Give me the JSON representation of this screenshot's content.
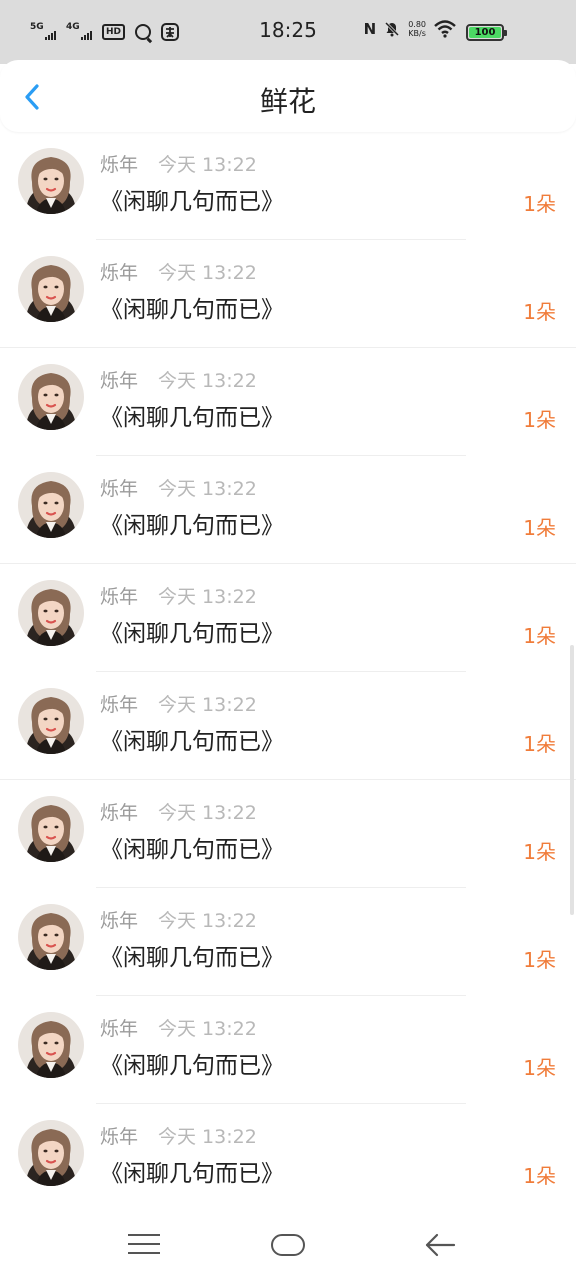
{
  "status_bar": {
    "time": "18:25",
    "sig1": "5G",
    "sig2": "4G",
    "hd": "HD",
    "speed_value": "0.80",
    "speed_unit": "KB/s",
    "battery": "100",
    "battery_color": "#4cd964"
  },
  "header": {
    "title": "鲜花",
    "back_icon": "chevron-left-icon",
    "accent_color": "#2a9df4"
  },
  "items": [
    {
      "name": "烁年",
      "time": "今天 13:22",
      "message": "《闲聊几句而已》",
      "count": "1朵"
    },
    {
      "name": "烁年",
      "time": "今天 13:22",
      "message": "《闲聊几句而已》",
      "count": "1朵"
    },
    {
      "name": "烁年",
      "time": "今天 13:22",
      "message": "《闲聊几句而已》",
      "count": "1朵"
    },
    {
      "name": "烁年",
      "time": "今天 13:22",
      "message": "《闲聊几句而已》",
      "count": "1朵"
    },
    {
      "name": "烁年",
      "time": "今天 13:22",
      "message": "《闲聊几句而已》",
      "count": "1朵"
    },
    {
      "name": "烁年",
      "time": "今天 13:22",
      "message": "《闲聊几句而已》",
      "count": "1朵"
    },
    {
      "name": "烁年",
      "time": "今天 13:22",
      "message": "《闲聊几句而已》",
      "count": "1朵"
    },
    {
      "name": "烁年",
      "time": "今天 13:22",
      "message": "《闲聊几句而已》",
      "count": "1朵"
    },
    {
      "name": "烁年",
      "time": "今天 13:22",
      "message": "《闲聊几句而已》",
      "count": "1朵"
    },
    {
      "name": "烁年",
      "time": "今天 13:22",
      "message": "《闲聊几句而已》",
      "count": "1朵"
    }
  ],
  "count_color": "#f07c3a",
  "navbar": {
    "menu_icon": "menu-icon",
    "home_icon": "home-icon",
    "back_icon": "back-arrow-icon"
  }
}
